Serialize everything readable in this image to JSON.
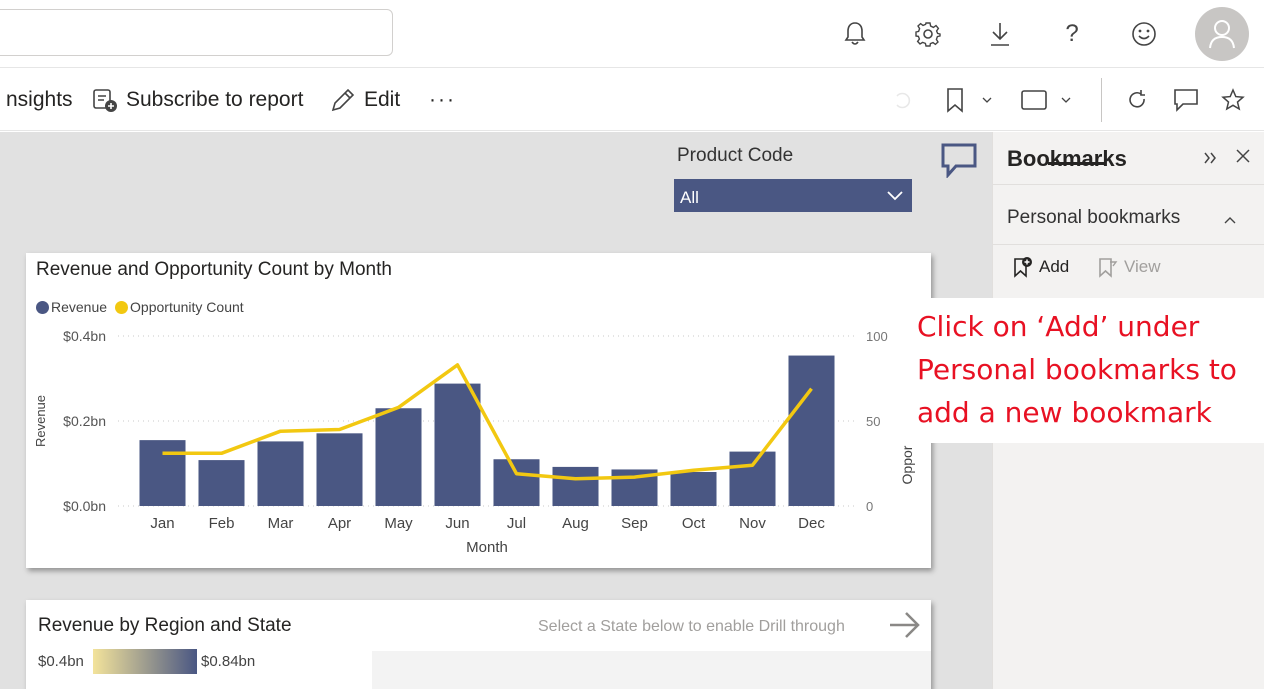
{
  "header": {
    "search_placeholder": "",
    "icons": [
      "bell-icon",
      "gear-icon",
      "download-icon",
      "help-icon",
      "feedback-smiley-icon",
      "user-avatar-icon"
    ]
  },
  "actionbar": {
    "insights_label": "nsights",
    "subscribe_label": "Subscribe to report",
    "edit_label": "Edit",
    "more_label": "···"
  },
  "slicer": {
    "title": "Product Code",
    "selected": "All"
  },
  "chart_card": {
    "title": "Revenue and Opportunity Count by Month"
  },
  "chart_data": {
    "type": "bar",
    "title": "Revenue and Opportunity Count by Month",
    "categories": [
      "Jan",
      "Feb",
      "Mar",
      "Apr",
      "May",
      "Jun",
      "Jul",
      "Aug",
      "Sep",
      "Oct",
      "Nov",
      "Dec"
    ],
    "series": [
      {
        "name": "Revenue",
        "type": "bar",
        "axis": "left",
        "color": "#4a5783",
        "values": [
          0.155,
          0.108,
          0.152,
          0.171,
          0.23,
          0.288,
          0.11,
          0.092,
          0.086,
          0.08,
          0.128,
          0.354
        ]
      },
      {
        "name": "Opportunity Count",
        "type": "line",
        "axis": "right",
        "color": "#f2c811",
        "values": [
          31,
          31,
          44,
          45,
          58,
          83,
          19,
          16,
          17,
          21,
          24,
          69
        ]
      }
    ],
    "xlabel": "Month",
    "ylabel": "Revenue",
    "y2label": "Oppor",
    "ylim": [
      0,
      0.4
    ],
    "y2lim": [
      0,
      100
    ],
    "yticks": [
      "$0.0bn",
      "$0.2bn",
      "$0.4bn"
    ],
    "y2ticks": [
      "0",
      "50",
      "100"
    ],
    "legend": [
      "Revenue",
      "Opportunity Count"
    ],
    "legend_position": "top-left",
    "grid": true
  },
  "region_card": {
    "title": "Revenue by Region and State",
    "hint": "Select a State below to enable Drill through",
    "gradient_min": "$0.4bn",
    "gradient_max": "$0.84bn",
    "gradient_colors": [
      "#f3e39b",
      "#4a5783"
    ]
  },
  "bookmarks": {
    "title": "Bookmarks",
    "section": "Personal bookmarks",
    "add_label": "Add",
    "view_label": "View"
  },
  "annotation": {
    "line1": "Click on ‘Add’ under",
    "line2": "Personal bookmarks to",
    "line3": "add a new bookmark",
    "color": "#e81123"
  },
  "colors": {
    "accent": "#4a5783",
    "line": "#f2c811",
    "canvas": "#e1e1e1"
  }
}
